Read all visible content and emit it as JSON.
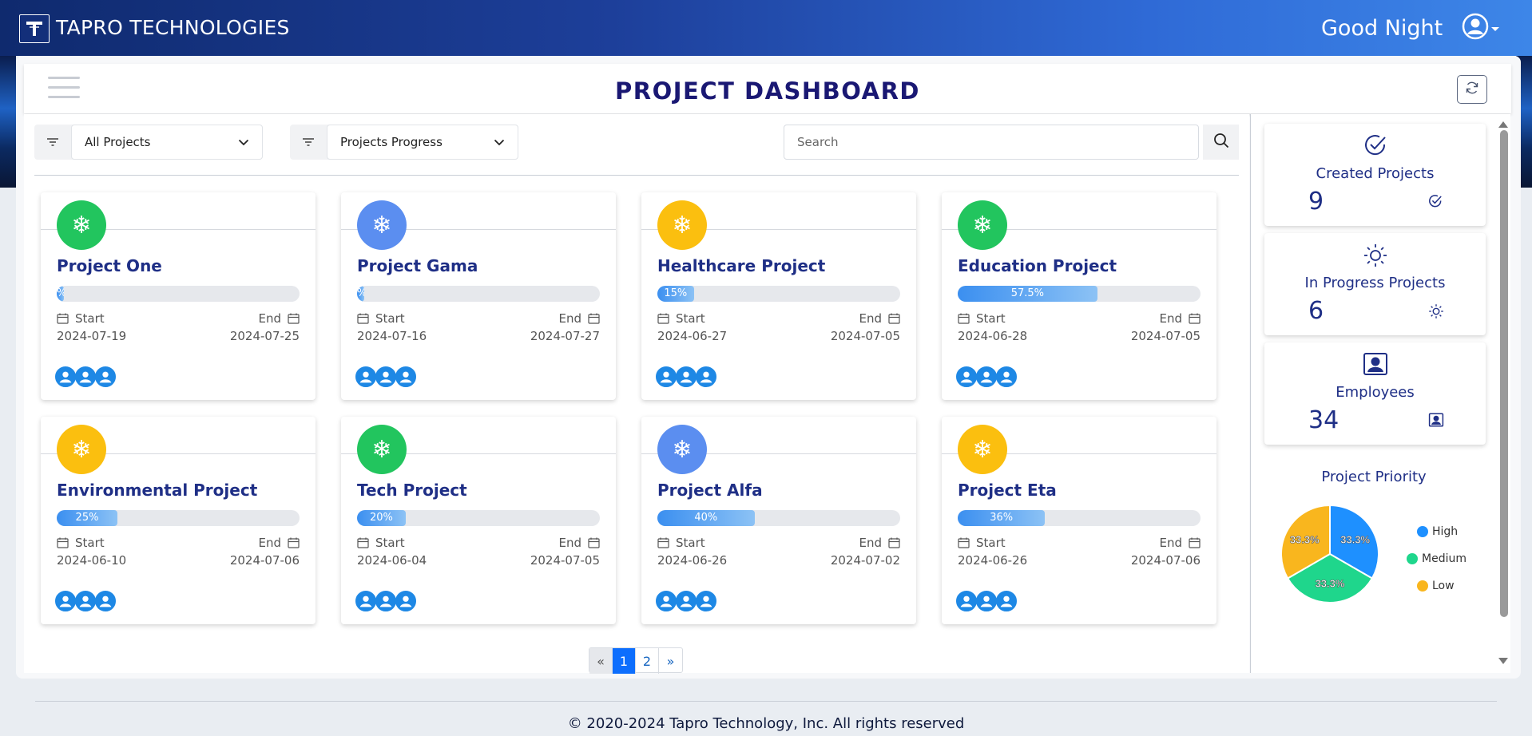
{
  "topbar": {
    "brand": "TAPRO TECHNOLOGIES",
    "greeting": "Good Night"
  },
  "header": {
    "title": "PROJECT DASHBOARD"
  },
  "filters": {
    "scope_value": "All Projects",
    "sort_value": "Projects Progress",
    "search_placeholder": "Search"
  },
  "labels": {
    "start": "Start",
    "end": "End"
  },
  "projects": [
    {
      "name": "Project One",
      "progress_label": "%",
      "progress": 3,
      "start": "2024-07-19",
      "end": "2024-07-25",
      "icon_color": "#22c55e"
    },
    {
      "name": "Project Gama",
      "progress_label": "%",
      "progress": 3,
      "start": "2024-07-16",
      "end": "2024-07-27",
      "icon_color": "#5b8ef0"
    },
    {
      "name": "Healthcare Project",
      "progress_label": "15%",
      "progress": 15,
      "start": "2024-06-27",
      "end": "2024-07-05",
      "icon_color": "#fbbf0f"
    },
    {
      "name": "Education Project",
      "progress_label": "57.5%",
      "progress": 57.5,
      "start": "2024-06-28",
      "end": "2024-07-05",
      "icon_color": "#22c55e"
    },
    {
      "name": "Environmental Project",
      "progress_label": "25%",
      "progress": 25,
      "start": "2024-06-10",
      "end": "2024-07-06",
      "icon_color": "#fbbf0f"
    },
    {
      "name": "Tech Project",
      "progress_label": "20%",
      "progress": 20,
      "start": "2024-06-04",
      "end": "2024-07-05",
      "icon_color": "#22c55e"
    },
    {
      "name": "Project Alfa",
      "progress_label": "40%",
      "progress": 40,
      "start": "2024-06-26",
      "end": "2024-07-02",
      "icon_color": "#5b8ef0"
    },
    {
      "name": "Project Eta",
      "progress_label": "36%",
      "progress": 36,
      "start": "2024-06-26",
      "end": "2024-07-06",
      "icon_color": "#fbbf0f"
    }
  ],
  "pagination": {
    "prev": "«",
    "pages": [
      "1",
      "2"
    ],
    "next": "»",
    "current": "1"
  },
  "stats": {
    "created": {
      "label": "Created Projects",
      "value": "9"
    },
    "in_progress": {
      "label": "In Progress Projects",
      "value": "6"
    },
    "employees": {
      "label": "Employees",
      "value": "34"
    }
  },
  "priority": {
    "title": "Project Priority",
    "slices": [
      {
        "name": "High",
        "percent": 33.3,
        "label": "33.3%",
        "color": "#1e90ff"
      },
      {
        "name": "Medium",
        "percent": 33.3,
        "label": "33.3%",
        "color": "#1fd68c"
      },
      {
        "name": "Low",
        "percent": 33.3,
        "label": "33.3%",
        "color": "#f9b61e"
      }
    ]
  },
  "footer": {
    "text": "© 2020-2024 Tapro Technology, Inc. All rights reserved"
  }
}
